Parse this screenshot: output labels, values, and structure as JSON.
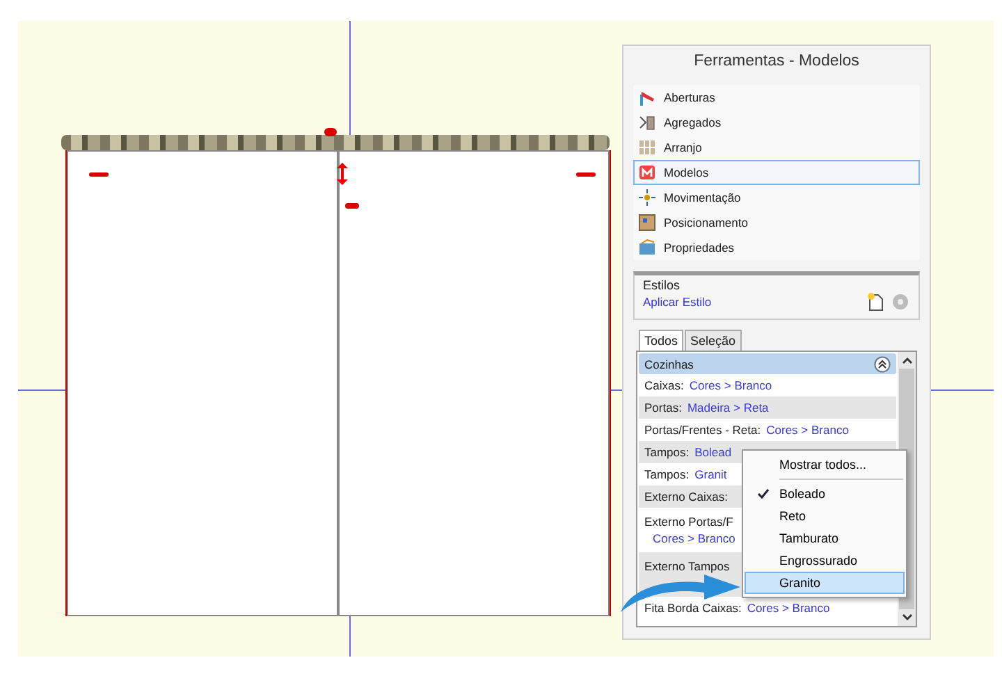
{
  "panel": {
    "title": "Ferramentas - Modelos",
    "nav_items": [
      {
        "label": "Aberturas",
        "selected": false
      },
      {
        "label": "Agregados",
        "selected": false
      },
      {
        "label": "Arranjo",
        "selected": false
      },
      {
        "label": "Modelos",
        "selected": true
      },
      {
        "label": "Movimentação",
        "selected": false
      },
      {
        "label": "Posicionamento",
        "selected": false
      },
      {
        "label": "Propriedades",
        "selected": false
      }
    ],
    "styles_group": {
      "title": "Estilos",
      "link": "Aplicar Estilo"
    },
    "tabs": [
      {
        "label": "Todos",
        "selected": true
      },
      {
        "label": "Seleção",
        "selected": false
      }
    ],
    "list": {
      "header": "Cozinhas",
      "rows": [
        {
          "label": "Caixas:",
          "value": "Cores > Branco"
        },
        {
          "label": "Portas:",
          "value": "Madeira > Reta"
        },
        {
          "label": "Portas/Frentes - Reta:",
          "value": "Cores > Branco"
        },
        {
          "label": "Tampos:",
          "value": "Bolead"
        },
        {
          "label": "Tampos:",
          "value": "Granit"
        },
        {
          "label": "Externo Caixas:",
          "value": ""
        },
        {
          "label": "Externo Portas/F",
          "value": "Cores > Branco"
        },
        {
          "label": "Externo Tampos",
          "value": ""
        },
        {
          "label": "Fita Borda Caixas:",
          "value": "Cores > Branco"
        }
      ]
    },
    "context_menu": [
      {
        "label": "Mostrar todos...",
        "kind": "command",
        "checked": false,
        "selected": false
      },
      {
        "label": "Boleado",
        "kind": "option",
        "checked": true,
        "selected": false
      },
      {
        "label": "Reto",
        "kind": "option",
        "checked": false,
        "selected": false
      },
      {
        "label": "Tamburato",
        "kind": "option",
        "checked": false,
        "selected": false
      },
      {
        "label": "Engrossurado",
        "kind": "option",
        "checked": false,
        "selected": false
      },
      {
        "label": "Granito",
        "kind": "option",
        "checked": false,
        "selected": true
      }
    ]
  }
}
